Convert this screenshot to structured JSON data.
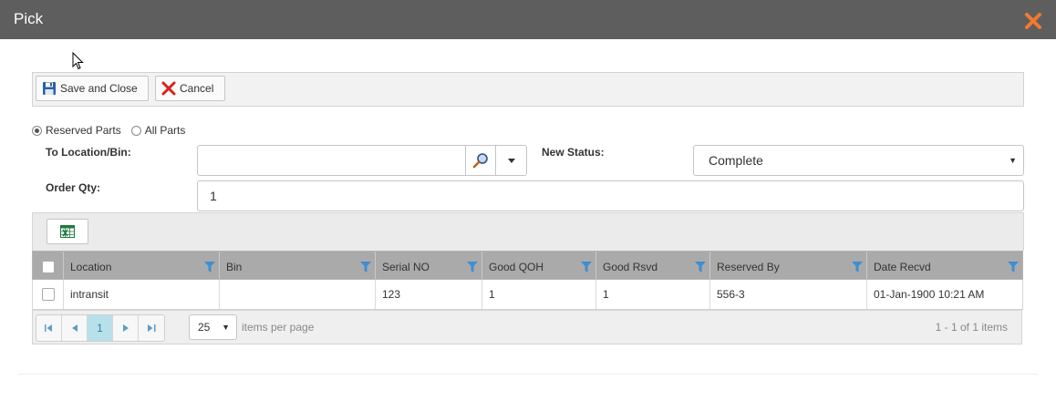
{
  "window": {
    "title": "Pick"
  },
  "toolbar": {
    "save_label": "Save and Close",
    "cancel_label": "Cancel"
  },
  "filters": {
    "reserved_parts_label": "Reserved Parts",
    "all_parts_label": "All Parts",
    "selected": "reserved_parts"
  },
  "form": {
    "to_location_label": "To Location/Bin:",
    "to_location_value": "",
    "new_status_label": "New Status:",
    "new_status_value": "Complete",
    "order_qty_label": "Order Qty:",
    "order_qty_value": "1"
  },
  "grid": {
    "columns": [
      "Location",
      "Bin",
      "Serial NO",
      "Good QOH",
      "Good Rsvd",
      "Reserved By",
      "Date Recvd"
    ],
    "rows": [
      {
        "location": "intransit",
        "bin": "",
        "serial_no": "123",
        "good_qoh": "1",
        "good_rsvd": "1",
        "reserved_by": "556-3",
        "date_recvd": "01-Jan-1900 10:21 AM"
      }
    ]
  },
  "pager": {
    "current_page": "1",
    "page_size": "25",
    "items_per_page_label": "items per page",
    "info": "1 - 1 of 1 items"
  },
  "colors": {
    "titlebar": "#5e5e5e",
    "header": "#aaaaaa",
    "filter_icon": "#3d8fd1",
    "close_icon": "#f07a30"
  }
}
